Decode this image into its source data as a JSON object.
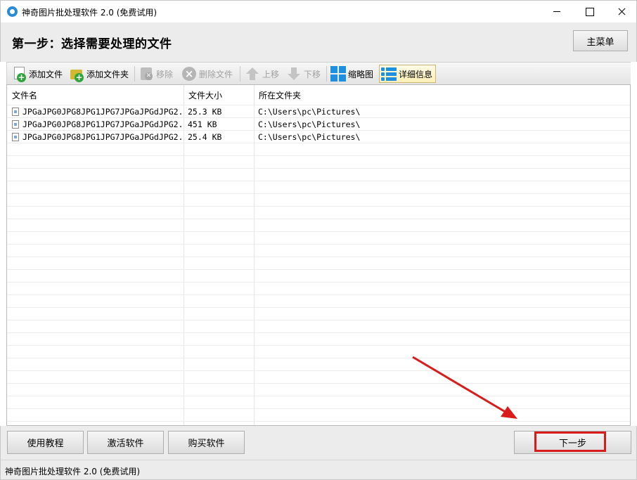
{
  "window": {
    "title": "神奇图片批处理软件 2.0 (免费试用)"
  },
  "step": {
    "title": "第一步：选择需要处理的文件",
    "main_menu_label": "主菜单"
  },
  "toolbar": {
    "add_file": "添加文件",
    "add_folder": "添加文件夹",
    "move": "移除",
    "delete_file": "删除文件",
    "move_up": "上移",
    "move_down": "下移",
    "thumbnail": "缩略图",
    "details": "详细信息"
  },
  "table": {
    "headers": [
      "文件名",
      "文件大小",
      "所在文件夹"
    ],
    "rows": [
      {
        "name": "JPGaJPG0JPG8JPG1JPG7JPGaJPGdJPG2...",
        "size": "25.3 KB",
        "folder": "C:\\Users\\pc\\Pictures\\"
      },
      {
        "name": "JPGaJPG0JPG8JPG1JPG7JPGaJPGdJPG2...",
        "size": "451 KB",
        "folder": "C:\\Users\\pc\\Pictures\\"
      },
      {
        "name": "JPGaJPG0JPG8JPG1JPG7JPGaJPGdJPG2...",
        "size": "25.4 KB",
        "folder": "C:\\Users\\pc\\Pictures\\"
      }
    ]
  },
  "buttons": {
    "tutorial": "使用教程",
    "activate": "激活软件",
    "buy": "购买软件",
    "next": "下一步"
  },
  "status": {
    "text": "神奇图片批处理软件 2.0 (免费试用)"
  },
  "colors": {
    "accent_blue": "#1f8fe0",
    "annotation_red": "#d81c1c"
  }
}
